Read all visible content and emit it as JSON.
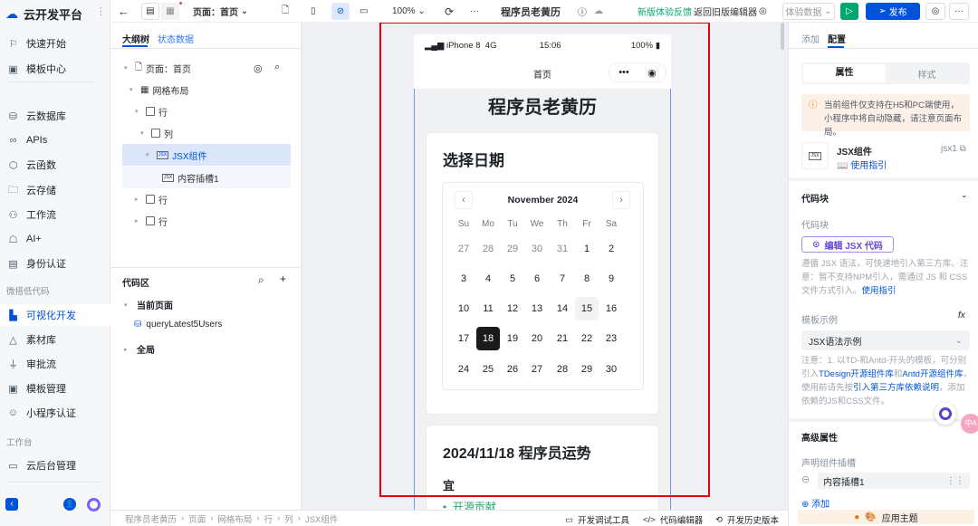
{
  "app": {
    "title": "云开发平台"
  },
  "sidebar": {
    "items": [
      {
        "label": "快速开始",
        "icon": "flag-icon"
      },
      {
        "label": "模板中心",
        "icon": "template-icon"
      },
      {
        "label": "云数据库",
        "icon": "database-icon"
      },
      {
        "label": "APIs",
        "icon": "link-icon"
      },
      {
        "label": "云函数",
        "icon": "function-icon"
      },
      {
        "label": "云存储",
        "icon": "folder-cloud-icon"
      },
      {
        "label": "工作流",
        "icon": "workflow-icon"
      },
      {
        "label": "AI+",
        "icon": "robot-icon"
      },
      {
        "label": "身份认证",
        "icon": "id-card-icon"
      }
    ],
    "section_lowcode": "微搭低代码",
    "lowcode_items": [
      {
        "label": "可视化开发",
        "icon": "layout-icon",
        "active": true
      },
      {
        "label": "素材库",
        "icon": "shapes-icon"
      },
      {
        "label": "审批流",
        "icon": "stamp-icon"
      },
      {
        "label": "模板管理",
        "icon": "template-icon"
      },
      {
        "label": "小程序认证",
        "icon": "chat-icon"
      }
    ],
    "section_workbench": "工作台",
    "workbench_items": [
      {
        "label": "云后台管理",
        "icon": "window-icon"
      }
    ]
  },
  "toolbar": {
    "page_select": "页面：首页",
    "zoom": "100%",
    "app_name": "程序员老黄历",
    "feedback": "新版体验反馈",
    "back_old": "返回旧版编辑器",
    "data_select": "体验数据",
    "publish": "发布",
    "accent": "#0052d9",
    "run_color": "#00a870"
  },
  "outline": {
    "tabs": [
      "大纲树",
      "状态数据"
    ],
    "tree": [
      {
        "label": "页面：首页",
        "depth": 0
      },
      {
        "label": "网格布局",
        "depth": 1
      },
      {
        "label": "行",
        "depth": 2
      },
      {
        "label": "列",
        "depth": 3
      },
      {
        "label": "JSX组件",
        "depth": 4,
        "selected": true
      },
      {
        "label": "内容插槽1",
        "depth": 5
      },
      {
        "label": "行",
        "depth": 2
      },
      {
        "label": "行",
        "depth": 2
      }
    ],
    "code_title": "代码区",
    "current_page": "当前页面",
    "query": "queryLatest5Users",
    "global": "全局"
  },
  "breadcrumb": [
    "程序员老黄历",
    "页面",
    "网格布局",
    "行",
    "列",
    "JSX组件"
  ],
  "statusbar": {
    "debug": "开发调试工具",
    "code_editor": "代码编辑器",
    "history": "开发历史版本"
  },
  "phone": {
    "carrier": "iPhone 8",
    "network": "4G",
    "time": "15:06",
    "battery": "100%",
    "nav_title": "首页",
    "page_title": "程序员老黄历",
    "card_title": "选择日期",
    "calendar": {
      "month": "November 2024",
      "weekdays": [
        "Su",
        "Mo",
        "Tu",
        "We",
        "Th",
        "Fr",
        "Sa"
      ],
      "days": [
        [
          "27",
          "28",
          "29",
          "30",
          "31",
          "1",
          "2"
        ],
        [
          "3",
          "4",
          "5",
          "6",
          "7",
          "8",
          "9"
        ],
        [
          "10",
          "11",
          "12",
          "13",
          "14",
          "15",
          "16"
        ],
        [
          "17",
          "18",
          "19",
          "20",
          "21",
          "22",
          "23"
        ],
        [
          "24",
          "25",
          "26",
          "27",
          "28",
          "29",
          "30"
        ]
      ],
      "selected": "18",
      "today": "15"
    },
    "fortune_title": "2024/11/18 程序员运势",
    "good_label": "宜",
    "good_items": [
      "开源贡献"
    ]
  },
  "right": {
    "tabs": [
      "添加",
      "配置"
    ],
    "seg": [
      "属性",
      "样式"
    ],
    "warning": "当前组件仅支持在H5和PC端使用，小程序中将自动隐藏，请注意页面布局。",
    "comp_name": "JSX组件",
    "comp_id": "jsx1",
    "guide": "使用指引",
    "code_section": "代码块",
    "code_label": "代码块",
    "edit_btn": "编辑 JSX 代码",
    "code_note": "遵循 JSX 语法，可快速地引入第三方库。注意：暂不支持NPM引入，需通过 JS 和 CSS 文件方式引入。",
    "code_note_link": "使用指引",
    "tpl_label": "模板示例",
    "tpl_value": "JSX语法示例",
    "tpl_note_1": "注意：1. 以TD-和Antd-开头的模板，可分别引入",
    "tpl_link_1": "TDesign开源组件库",
    "tpl_and": "和",
    "tpl_link_2": "Antd开源组件库",
    "tpl_note_2": "，使用前请先按",
    "tpl_link_3": "引入第三方库依赖说明",
    "tpl_note_3": "，添加依赖的JS和CSS文件。",
    "adv_section": "高级属性",
    "slot_label": "声明组件插槽",
    "slot_value": "内容插槽1",
    "add": "添加",
    "theme": "应用主题"
  }
}
